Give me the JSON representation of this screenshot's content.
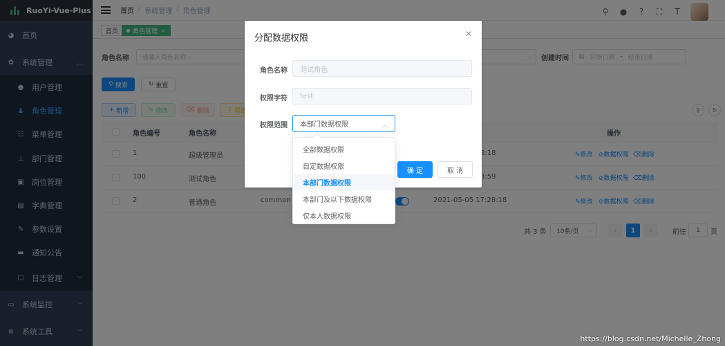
{
  "app": {
    "title": "RuoYi-Vue-Plus"
  },
  "sidebar": {
    "items": [
      {
        "label": "首页",
        "icon": "dashboard-icon"
      },
      {
        "label": "系统管理",
        "icon": "gear-icon"
      },
      {
        "label": "用户管理",
        "icon": "user-icon"
      },
      {
        "label": "角色管理",
        "icon": "peoples-icon",
        "active": true
      },
      {
        "label": "菜单管理",
        "icon": "tree-table-icon"
      },
      {
        "label": "部门管理",
        "icon": "tree-icon"
      },
      {
        "label": "岗位管理",
        "icon": "post-icon"
      },
      {
        "label": "字典管理",
        "icon": "dict-icon"
      },
      {
        "label": "参数设置",
        "icon": "edit-icon"
      },
      {
        "label": "通知公告",
        "icon": "message-icon"
      },
      {
        "label": "日志管理",
        "icon": "log-icon"
      },
      {
        "label": "系统监控",
        "icon": "monitor-icon"
      },
      {
        "label": "系统工具",
        "icon": "tool-icon"
      }
    ]
  },
  "navbar": {
    "breadcrumb": [
      "首页",
      "系统管理",
      "角色管理"
    ]
  },
  "tags": [
    {
      "label": "首页"
    },
    {
      "label": "角色管理"
    }
  ],
  "search": {
    "role_name_label": "角色名称",
    "role_name_placeholder": "请输入角色名称",
    "create_time_label": "创建时间",
    "start_placeholder": "开始日期",
    "end_placeholder": "结束日期",
    "range_sep": "-",
    "search_btn": "搜索",
    "reset_btn": "重置"
  },
  "toolbar": {
    "add": "新增",
    "edit": "修改",
    "delete": "删除",
    "export": "导出"
  },
  "table": {
    "headers": {
      "id": "角色编号",
      "name": "角色名称",
      "ops": "操作"
    },
    "rows": [
      {
        "id": "1",
        "name": "超级管理员",
        "key": "",
        "time_tail": "8:18"
      },
      {
        "id": "100",
        "name": "测试角色",
        "key": "",
        "time_tail": "3:59"
      },
      {
        "id": "2",
        "name": "普通角色",
        "key": "common",
        "time": "2021-05-05 17:28:18"
      }
    ],
    "op_edit": "修改",
    "op_data_scope": "数据权限",
    "op_delete": "删除"
  },
  "pagination": {
    "total": "共 3 条",
    "page_size": "10条/页",
    "current": "1",
    "goto_label": "前往",
    "goto_value": "1",
    "page_unit": "页"
  },
  "dialog": {
    "title": "分配数据权限",
    "role_name_label": "角色名称",
    "role_name_value": "测试角色",
    "role_key_label": "权限字符",
    "role_key_value": "test",
    "scope_label": "权限范围",
    "scope_value": "本部门数据权限",
    "confirm": "确 定",
    "cancel": "取 消"
  },
  "dropdown": {
    "options": [
      "全部数据权限",
      "自定数据权限",
      "本部门数据权限",
      "本部门及以下数据权限",
      "仅本人数据权限"
    ],
    "selected_index": 2
  },
  "watermark": "https://blog.csdn.net/Michelle_Zhong",
  "colors": {
    "primary": "#1890ff",
    "sidebar_bg": "#304156",
    "tag_active": "#42b983"
  }
}
